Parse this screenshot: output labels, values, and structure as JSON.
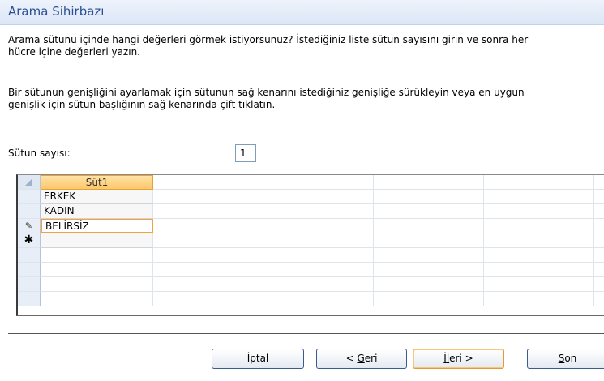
{
  "window": {
    "title": "Arama Sihirbazı"
  },
  "instructions": {
    "line1a": "Arama sütunu içinde hangi değerleri görmek istiyorsunuz? İstediğiniz liste sütun sayısını girin ve sonra her",
    "line1b": "hücre içine değerleri yazın.",
    "line2a": "Bir sütunun genişliğini ayarlamak için sütunun sağ kenarını istediğiniz genişliğe sürükleyin veya en uygun",
    "line2b": "genişlik için sütun başlığının sağ kenarında çift tıklatın."
  },
  "column_count": {
    "label": "Sütun sayısı:",
    "value": "1"
  },
  "grid": {
    "header": "Süt1",
    "rows": [
      "ERKEK",
      "KADIN",
      "BELİRSİZ",
      ""
    ],
    "row_markers": [
      "",
      "",
      "pencil",
      "new"
    ]
  },
  "buttons": {
    "cancel": "İptal",
    "back_prefix": "< ",
    "back_key": "G",
    "back_rest": "eri",
    "next_key": "İ",
    "next_mid": "l",
    "next_rest": "eri >",
    "finish_key": "S",
    "finish_rest": "on"
  }
}
